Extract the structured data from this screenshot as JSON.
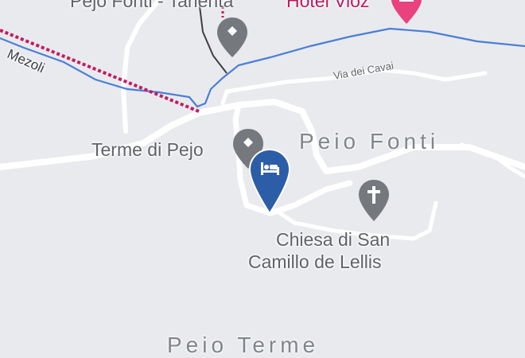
{
  "map": {
    "colors": {
      "background": "#e9eaee",
      "road": "#ffffff",
      "river": "#4a7fd6",
      "rail": "#c51a5e",
      "pin_gray": "#75797e",
      "pin_hotel_blue": "#2c5ea8",
      "pin_pink": "#e8437e"
    },
    "labels": {
      "top_poi_partial": "Pejo Fonti - Tarlenta",
      "hotel_vioz": "Hotel Vioz",
      "road_mezoli": "Mezoli",
      "road_via_dei_cavai": "Via dei Cavai",
      "area_peio_fonti": "Peio Fonti",
      "poi_terme_di_pejo": "Terme di Pejo",
      "church_line1": "Chiesa di San",
      "church_line2": "Camillo de Lellis",
      "area_peio_terme": "Peio Terme"
    },
    "markers": [
      {
        "name": "Pejo Fonti - Tarlenta",
        "type": "gray-place-pin",
        "icon": "place-pin-icon"
      },
      {
        "name": "Hotel Vioz",
        "type": "pink-hotel-pin",
        "icon": "hotel-pin-icon"
      },
      {
        "name": "Terme di Pejo",
        "type": "gray-place-pin",
        "icon": "place-pin-icon"
      },
      {
        "name": "Selected hotel",
        "type": "blue-hotel-pin",
        "icon": "bed-icon"
      },
      {
        "name": "Chiesa di San Camillo de Lellis",
        "type": "gray-church-pin",
        "icon": "cross-icon"
      }
    ]
  }
}
